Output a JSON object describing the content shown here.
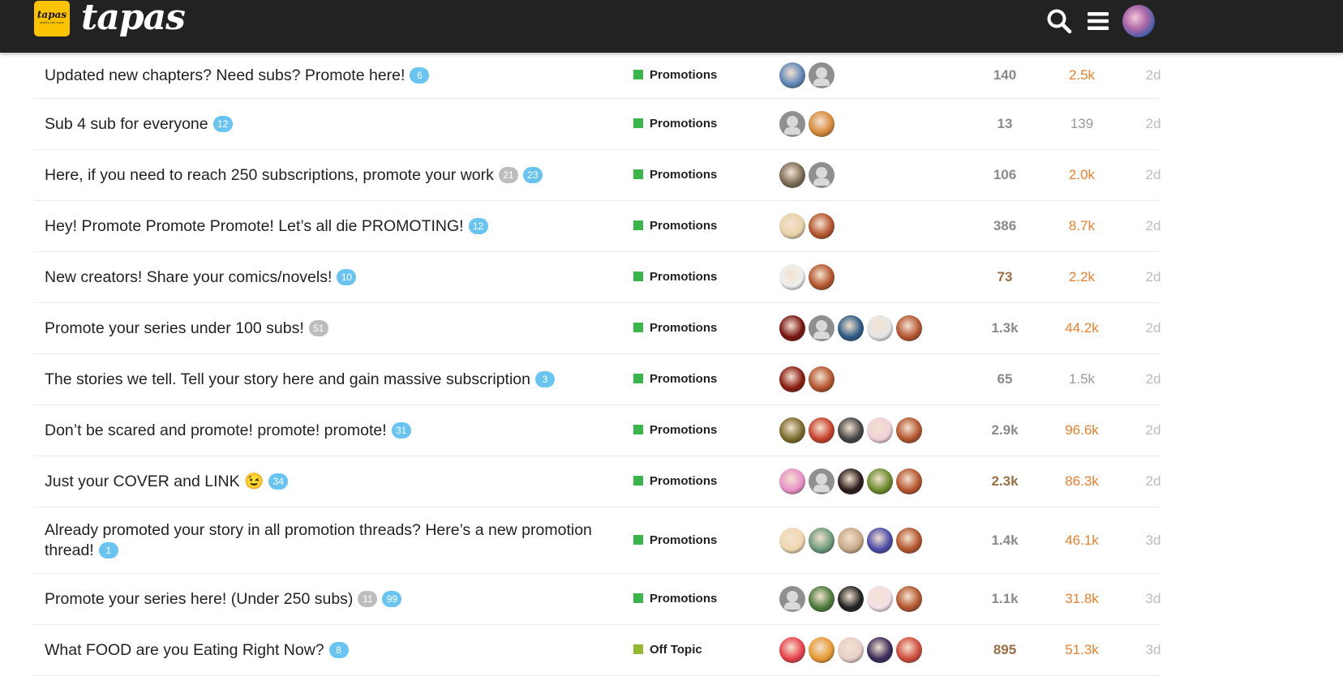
{
  "header": {
    "logo_badge_text": "tapas",
    "logo_badge_sub": "stories you crave",
    "wordmark": "tapas",
    "icons": [
      "search-icon",
      "hamburger-menu-icon",
      "user-avatar"
    ]
  },
  "colors": {
    "header_bg": "#222222",
    "brand_yellow": "#fbc300",
    "promotions": "#3ab54a",
    "off_topic": "#92b82d",
    "badge_blue": "#6ac4f2",
    "badge_gray": "#bdbdbd",
    "views_hot": "#e8802d",
    "replies_gray": "#8a8a8a",
    "replies_hot": "#9b6e45"
  },
  "topics": [
    {
      "title": "Updated new chapters? Need subs? Promote here!",
      "badges": [
        {
          "value": "6",
          "kind": "blue"
        }
      ],
      "category": "Promotions",
      "cat_color": "#3ab54a",
      "posters": [
        "#5e86b8",
        "default"
      ],
      "replies": "140",
      "views": "2.5k",
      "activity": "2d",
      "replies_color": "#8a8a8a",
      "views_color": "#e8802d"
    },
    {
      "title": "Sub 4 sub for everyone",
      "badges": [
        {
          "value": "12",
          "kind": "blue"
        }
      ],
      "category": "Promotions",
      "cat_color": "#3ab54a",
      "posters": [
        "default",
        "#d88a3a"
      ],
      "replies": "13",
      "views": "139",
      "activity": "2d",
      "replies_color": "#8a8a8a",
      "views_color": "#9a9a9a"
    },
    {
      "title": "Here, if you need to reach 250 subscriptions, promote your work",
      "badges": [
        {
          "value": "21",
          "kind": "gray"
        },
        {
          "value": "23",
          "kind": "blue"
        }
      ],
      "category": "Promotions",
      "cat_color": "#3ab54a",
      "posters": [
        "#7a6a55",
        "default"
      ],
      "replies": "106",
      "views": "2.0k",
      "activity": "2d",
      "replies_color": "#8a8a8a",
      "views_color": "#e8802d"
    },
    {
      "title": "Hey! Promote Promote Promote! Let’s all die PROMOTING!",
      "badges": [
        {
          "value": "12",
          "kind": "blue"
        }
      ],
      "category": "Promotions",
      "cat_color": "#3ab54a",
      "posters": [
        "#e8d2a8",
        "#b4542c"
      ],
      "replies": "386",
      "views": "8.7k",
      "activity": "2d",
      "replies_color": "#8a8a8a",
      "views_color": "#e8802d"
    },
    {
      "title": "New creators! Share your comics/novels!",
      "badges": [
        {
          "value": "10",
          "kind": "blue"
        }
      ],
      "category": "Promotions",
      "cat_color": "#3ab54a",
      "posters": [
        "#eeeeee",
        "#b4542c"
      ],
      "replies": "73",
      "views": "2.2k",
      "activity": "2d",
      "replies_color": "#9b6e45",
      "views_color": "#e8802d"
    },
    {
      "title": "Promote your series under 100 subs!",
      "badges": [
        {
          "value": "51",
          "kind": "gray"
        }
      ],
      "category": "Promotions",
      "cat_color": "#3ab54a",
      "posters": [
        "#7a1410",
        "default",
        "#2c5a86",
        "#e6e6e6",
        "#b4542c"
      ],
      "replies": "1.3k",
      "views": "44.2k",
      "activity": "2d",
      "replies_color": "#8a8a8a",
      "views_color": "#e8802d"
    },
    {
      "title": "The stories we tell. Tell your story here and gain massive subscription",
      "badges": [
        {
          "value": "3",
          "kind": "blue"
        }
      ],
      "category": "Promotions",
      "cat_color": "#3ab54a",
      "posters": [
        "#8a1c12",
        "#b4542c"
      ],
      "replies": "65",
      "views": "1.5k",
      "activity": "2d",
      "replies_color": "#8a8a8a",
      "views_color": "#9a9a9a"
    },
    {
      "title": "Don’t be scared and promote! promote! promote!",
      "badges": [
        {
          "value": "31",
          "kind": "blue"
        }
      ],
      "category": "Promotions",
      "cat_color": "#3ab54a",
      "posters": [
        "#7a6a2a",
        "#c8402a",
        "#444444",
        "#f0d0d8",
        "#b4542c"
      ],
      "replies": "2.9k",
      "views": "96.6k",
      "activity": "2d",
      "replies_color": "#8a8a8a",
      "views_color": "#e8802d"
    },
    {
      "title": "Just your COVER and LINK 😉",
      "badges": [
        {
          "value": "34",
          "kind": "blue"
        }
      ],
      "category": "Promotions",
      "cat_color": "#3ab54a",
      "posters": [
        "#e890c8",
        "default",
        "#2a1a1a",
        "#6a8a2a",
        "#b4542c"
      ],
      "replies": "2.3k",
      "views": "86.3k",
      "activity": "2d",
      "replies_color": "#9b6e45",
      "views_color": "#e8802d"
    },
    {
      "title": "Already promoted your story in all promotion threads? Here’s a new promotion thread!",
      "badges": [
        {
          "value": "1",
          "kind": "blue"
        }
      ],
      "category": "Promotions",
      "cat_color": "#3ab54a",
      "posters": [
        "#f0d8b0",
        "#6a9a7a",
        "#c8a888",
        "#4a4aa8",
        "#b4542c"
      ],
      "replies": "1.4k",
      "views": "46.1k",
      "activity": "3d",
      "replies_color": "#8a8a8a",
      "views_color": "#e8802d"
    },
    {
      "title": "Promote your series here! (Under 250 subs)",
      "badges": [
        {
          "value": "11",
          "kind": "gray"
        },
        {
          "value": "99",
          "kind": "blue"
        }
      ],
      "category": "Promotions",
      "cat_color": "#3ab54a",
      "posters": [
        "default",
        "#4a7a3a",
        "#202020",
        "#f4e0e8",
        "#b4542c"
      ],
      "replies": "1.1k",
      "views": "31.8k",
      "activity": "3d",
      "replies_color": "#8a8a8a",
      "views_color": "#e8802d"
    },
    {
      "title": "What FOOD are you Eating Right Now?",
      "badges": [
        {
          "value": "8",
          "kind": "blue"
        }
      ],
      "category": "Off Topic",
      "cat_color": "#92b82d",
      "posters": [
        "#e8404a",
        "#e89a30",
        "#e8d0c8",
        "#3a2a5a",
        "#d04a3a"
      ],
      "replies": "895",
      "views": "51.3k",
      "activity": "3d",
      "replies_color": "#9b6e45",
      "views_color": "#e8802d"
    }
  ]
}
